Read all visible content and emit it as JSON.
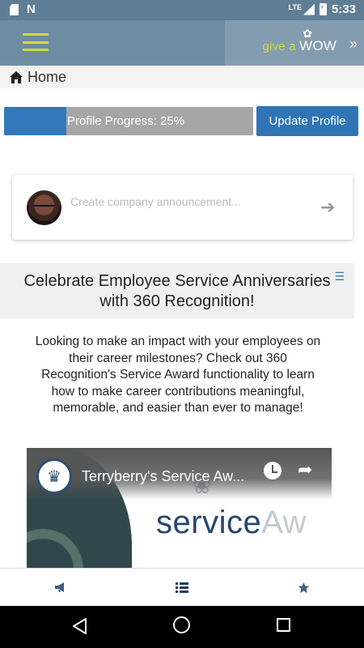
{
  "status_bar": {
    "time": "5:33",
    "network": "LTE"
  },
  "header": {
    "brand_give": "give a ",
    "brand_wow": "WOW",
    "brand_arrow": "»",
    "brand_color": "#d2dc3b"
  },
  "breadcrumb": {
    "label": "Home"
  },
  "profile": {
    "progress_label": "Profile Progress: 25%",
    "progress_fraction": 0.25,
    "update_button": "Update Profile"
  },
  "announcement": {
    "placeholder": "Create company announcement..."
  },
  "post": {
    "title": "Celebrate Employee Service Anniversaries with 360 Recognition!",
    "body": "Looking to make an impact with your employees on their career milestones? Check out 360 Recognition's Service Award functionality to learn how to make career contributions meaningful, memorable, and easier than ever to manage!",
    "video": {
      "title": "Terryberry's Service Aw...",
      "overlay_text_main": "service",
      "overlay_text_faded": "Aw"
    }
  },
  "tabs": [
    {
      "icon": "megaphone-icon"
    },
    {
      "icon": "list-icon"
    },
    {
      "icon": "star-icon"
    }
  ],
  "colors": {
    "header": "#6f8ca2",
    "accent_blue": "#2f75b5",
    "progress_track": "#a6a6a6"
  }
}
